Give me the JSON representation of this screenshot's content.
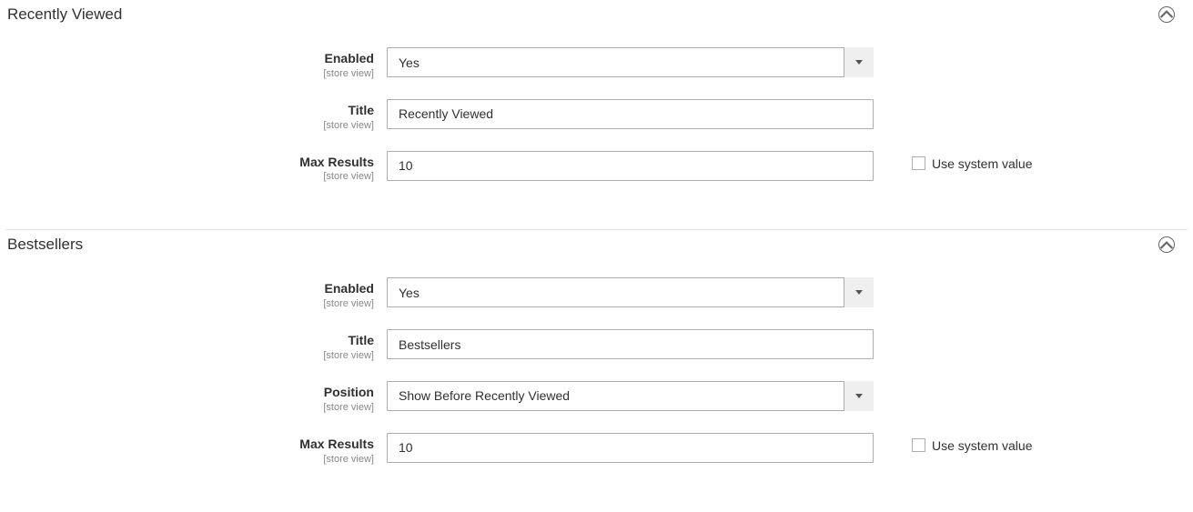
{
  "scope_label": "[store view]",
  "use_system_label": "Use system value",
  "sections": {
    "recently_viewed": {
      "title": "Recently Viewed",
      "fields": {
        "enabled": {
          "label": "Enabled",
          "value": "Yes"
        },
        "title": {
          "label": "Title",
          "value": "Recently Viewed"
        },
        "max_results": {
          "label": "Max Results",
          "value": "10"
        }
      }
    },
    "bestsellers": {
      "title": "Bestsellers",
      "fields": {
        "enabled": {
          "label": "Enabled",
          "value": "Yes"
        },
        "title": {
          "label": "Title",
          "value": "Bestsellers"
        },
        "position": {
          "label": "Position",
          "value": "Show Before Recently Viewed"
        },
        "max_results": {
          "label": "Max Results",
          "value": "10"
        }
      }
    }
  }
}
